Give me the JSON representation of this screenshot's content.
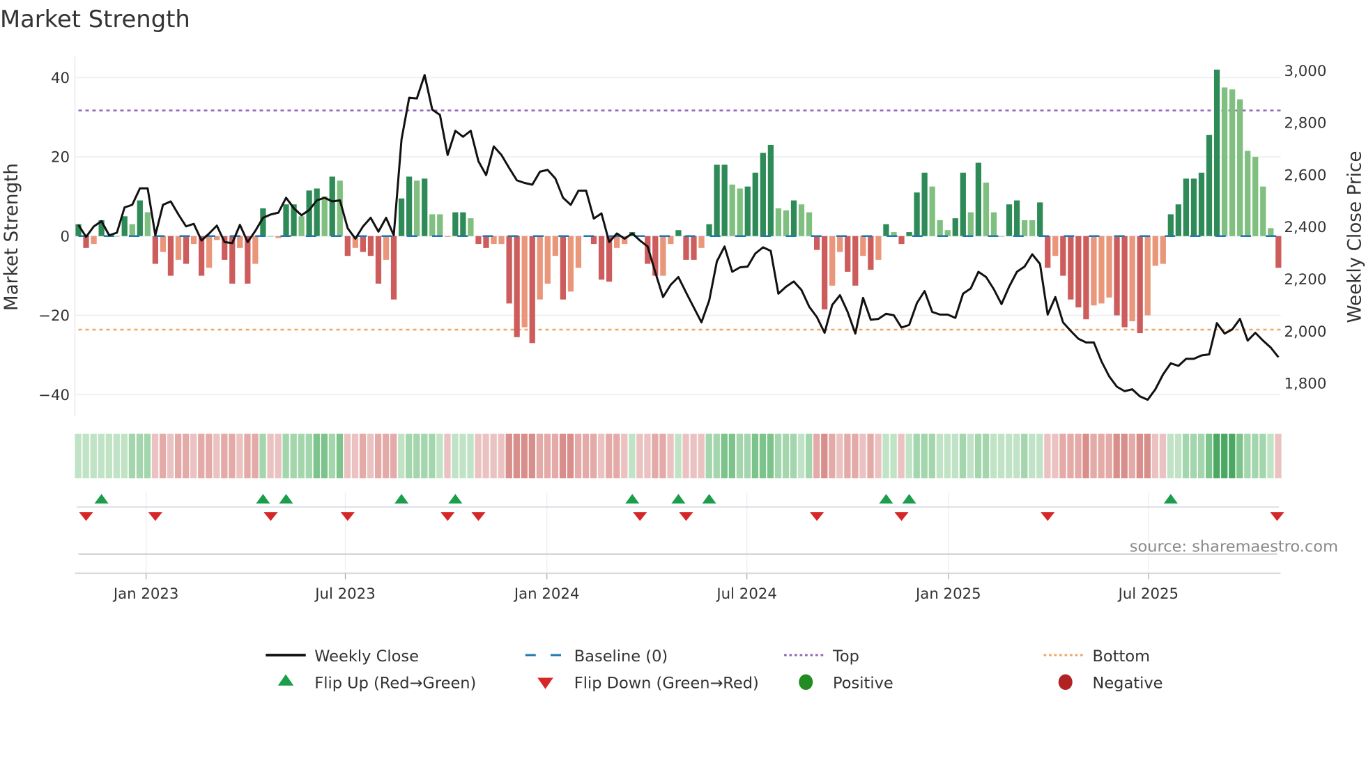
{
  "chart_data": {
    "type": "bar",
    "title": "Market Strength",
    "ylabel": "Market Strength",
    "y2label": "Weekly Close Price",
    "ylim": [
      -45,
      44
    ],
    "y2lim": [
      1700,
      3030
    ],
    "left_ticks": [
      "40",
      "20",
      "0",
      "−20",
      "−40"
    ],
    "left_tick_values": [
      40,
      20,
      0,
      -20,
      -40
    ],
    "right_ticks": [
      "3,000",
      "2,800",
      "2,600",
      "2,400",
      "2,200",
      "2,000",
      "1,800"
    ],
    "right_tick_values": [
      3000,
      2800,
      2600,
      2400,
      2200,
      2000,
      1800
    ],
    "x_ticks": [
      "Jan 2023",
      "Jul 2023",
      "Jan 2024",
      "Jul 2024",
      "Jan 2025",
      "Jul 2025"
    ],
    "x_tick_week_index": [
      8.8,
      34.7,
      60.9,
      86.9,
      113.1,
      139.1
    ],
    "top_level": 31.7,
    "bottom_level": -23.6,
    "baseline": 0,
    "grid": true,
    "legend_position": "bottom",
    "colors": {
      "strong_positive": "#2e8b57",
      "weak_positive": "#7fbf7f",
      "strong_negative": "#cd5c5c",
      "weak_negative": "#e9967a",
      "close_line": "#111111",
      "baseline": "#1f77b4",
      "top": "#9467bd",
      "bottom": "#f4a460",
      "flip_up": "#1a9e4a",
      "flip_down": "#d62728",
      "positive_dot": "#228b22",
      "negative_dot": "#b22222"
    },
    "strength": [
      3,
      -3,
      -2,
      4,
      0,
      0,
      5,
      3,
      9,
      6,
      -7,
      -4,
      -10,
      -6,
      -7,
      -2,
      -10,
      -8,
      -1,
      -6,
      -12,
      -3,
      -12,
      -7,
      7,
      0,
      -0.5,
      8,
      8,
      5,
      11.5,
      12,
      10,
      15,
      14,
      -5,
      -3,
      -4,
      -5,
      -12,
      -6,
      -16,
      9.5,
      15,
      14,
      14.5,
      5.5,
      5.5,
      -0.2,
      6,
      6,
      4.5,
      -2,
      -3,
      -2,
      -2,
      -17,
      -25.5,
      -23,
      -27,
      -16,
      -12,
      -5,
      -16,
      -14,
      -8,
      0,
      -2,
      -11,
      -11.5,
      -3,
      -2,
      1,
      0,
      -7,
      -10,
      -10,
      -2,
      1.5,
      -6,
      -6,
      -3,
      3,
      18,
      18,
      13,
      12,
      12.5,
      16,
      21,
      23,
      7,
      6.5,
      9,
      8,
      6,
      -3.5,
      -18.5,
      -12.5,
      -4,
      -9,
      -12.5,
      -5,
      -8.5,
      -6,
      3,
      1,
      -2,
      1,
      11,
      16,
      12.5,
      4,
      1.5,
      4.5,
      16,
      6,
      18.5,
      13.5,
      6,
      0,
      8,
      9,
      4,
      4,
      8.5,
      -8,
      -5,
      -10,
      -16,
      -18,
      -21,
      -17.5,
      -17,
      -15.5,
      -20,
      -23,
      -21.5,
      -24.5,
      -20,
      -7.5,
      -7,
      5.5,
      8,
      14.5,
      14.5,
      16,
      25.5,
      42,
      37.5,
      37,
      34.5,
      21.5,
      20,
      12.5,
      2,
      -8
    ],
    "strength_strong": [
      1,
      1,
      0,
      1,
      0,
      0,
      1,
      0,
      1,
      0,
      1,
      0,
      1,
      0,
      1,
      0,
      1,
      0,
      0,
      1,
      1,
      0,
      1,
      0,
      1,
      0,
      0,
      1,
      1,
      0,
      1,
      1,
      0,
      1,
      0,
      1,
      0,
      1,
      1,
      1,
      0,
      1,
      1,
      1,
      0,
      1,
      0,
      0,
      0,
      1,
      1,
      0,
      1,
      1,
      0,
      0,
      1,
      1,
      0,
      1,
      0,
      0,
      0,
      1,
      0,
      0,
      0,
      1,
      1,
      1,
      0,
      0,
      1,
      0,
      1,
      1,
      0,
      0,
      1,
      1,
      1,
      0,
      1,
      1,
      1,
      0,
      0,
      1,
      1,
      1,
      1,
      0,
      0,
      1,
      0,
      0,
      1,
      1,
      0,
      0,
      1,
      1,
      0,
      1,
      0,
      1,
      0,
      1,
      1,
      1,
      1,
      0,
      0,
      0,
      1,
      1,
      0,
      1,
      0,
      0,
      0,
      1,
      1,
      0,
      0,
      1,
      1,
      0,
      1,
      1,
      1,
      1,
      0,
      0,
      0,
      1,
      1,
      0,
      1,
      0,
      0,
      0,
      1,
      1,
      1,
      1,
      1,
      1,
      1,
      0,
      0,
      0,
      0,
      0,
      0,
      0,
      1
    ],
    "weekly_close": [
      2408,
      2362,
      2402,
      2422,
      2368,
      2378,
      2475,
      2485,
      2548,
      2548,
      2368,
      2485,
      2498,
      2448,
      2402,
      2412,
      2348,
      2375,
      2405,
      2342,
      2338,
      2408,
      2342,
      2385,
      2435,
      2448,
      2455,
      2512,
      2472,
      2445,
      2465,
      2502,
      2512,
      2498,
      2502,
      2395,
      2355,
      2402,
      2435,
      2382,
      2435,
      2368,
      2736,
      2896,
      2893,
      2983,
      2850,
      2830,
      2676,
      2769,
      2746,
      2769,
      2652,
      2599,
      2709,
      2676,
      2626,
      2579,
      2569,
      2562,
      2612,
      2619,
      2586,
      2512,
      2485,
      2539,
      2539,
      2432,
      2452,
      2342,
      2375,
      2355,
      2375,
      2348,
      2325,
      2225,
      2131,
      2178,
      2208,
      2148,
      2091,
      2034,
      2118,
      2268,
      2325,
      2228,
      2245,
      2248,
      2298,
      2322,
      2308,
      2144,
      2171,
      2191,
      2158,
      2094,
      2054,
      1994,
      2101,
      2138,
      2074,
      1991,
      2128,
      2044,
      2047,
      2067,
      2061,
      2014,
      2024,
      2108,
      2154,
      2074,
      2064,
      2064,
      2051,
      2144,
      2164,
      2228,
      2208,
      2161,
      2104,
      2171,
      2228,
      2248,
      2295,
      2258,
      2064,
      2131,
      2034,
      2001,
      1971,
      1957,
      1957,
      1884,
      1827,
      1787,
      1770,
      1777,
      1750,
      1737,
      1777,
      1834,
      1877,
      1867,
      1894,
      1894,
      1907,
      1911,
      2031,
      1991,
      2007,
      2047,
      1964,
      1994,
      1964,
      1937,
      1900
    ],
    "regime_strip": [
      1,
      1,
      1,
      1,
      1,
      1,
      1,
      2,
      2,
      2,
      -1,
      -2,
      -1,
      -2,
      -2,
      -1,
      -2,
      -2,
      -1,
      -2,
      -2,
      -1,
      -2,
      -2,
      2,
      -1,
      -1,
      2,
      2,
      2,
      2,
      3,
      3,
      2,
      3,
      -1,
      -1,
      -2,
      -1,
      -2,
      -2,
      -2,
      1,
      2,
      2,
      2,
      2,
      1,
      -1,
      1,
      1,
      1,
      -1,
      -1,
      -1,
      -1,
      -3,
      -3,
      -3,
      -3,
      -2,
      -2,
      -2,
      -3,
      -3,
      -2,
      -2,
      -2,
      -1,
      -2,
      -2,
      -1,
      1,
      -1,
      -1,
      -2,
      -2,
      -1,
      1,
      -1,
      -1,
      -1,
      2,
      2,
      3,
      3,
      2,
      2,
      3,
      3,
      3,
      2,
      2,
      2,
      1,
      2,
      -2,
      -3,
      -2,
      -1,
      -2,
      -2,
      -1,
      -2,
      -1,
      1,
      1,
      -1,
      1,
      2,
      2,
      2,
      1,
      1,
      1,
      2,
      1,
      2,
      2,
      1,
      1,
      1,
      1,
      2,
      1,
      1,
      -1,
      -1,
      -2,
      -2,
      -2,
      -3,
      -2,
      -2,
      -2,
      -3,
      -3,
      -2,
      -3,
      -3,
      -1,
      -1,
      1,
      1,
      2,
      2,
      2,
      3,
      4,
      4,
      4,
      3,
      2,
      2,
      2,
      1,
      -1
    ],
    "flip_up_weeks": [
      3,
      24,
      27,
      42,
      49,
      72,
      78,
      82,
      105,
      108,
      142
    ],
    "flip_down_weeks": [
      1,
      10,
      25,
      35,
      48,
      52,
      73,
      79,
      96,
      107,
      126,
      156
    ],
    "legend": [
      {
        "label": "Weekly Close",
        "symbol": "line"
      },
      {
        "label": "Baseline (0)",
        "symbol": "dashed"
      },
      {
        "label": "Top",
        "symbol": "dotted-purple"
      },
      {
        "label": "Bottom",
        "symbol": "dotted-orange"
      },
      {
        "label": "Flip Up (Red→Green)",
        "symbol": "triangle-up"
      },
      {
        "label": "Flip Down (Green→Red)",
        "symbol": "triangle-down"
      },
      {
        "label": "Positive",
        "symbol": "dot-green"
      },
      {
        "label": "Negative",
        "symbol": "dot-red"
      }
    ],
    "source": "source: sharemaestro.com"
  }
}
